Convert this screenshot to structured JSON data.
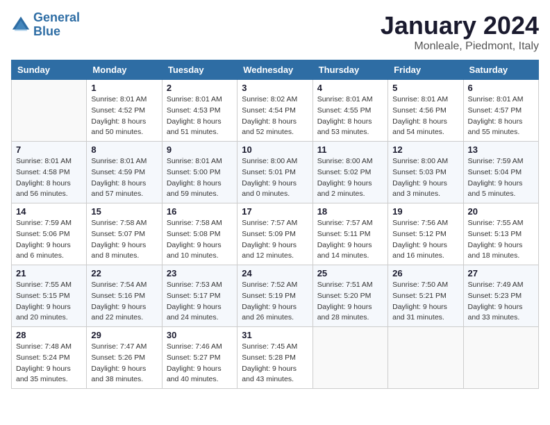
{
  "logo": {
    "line1": "General",
    "line2": "Blue"
  },
  "title": "January 2024",
  "subtitle": "Monleale, Piedmont, Italy",
  "weekdays": [
    "Sunday",
    "Monday",
    "Tuesday",
    "Wednesday",
    "Thursday",
    "Friday",
    "Saturday"
  ],
  "weeks": [
    [
      {
        "day": "",
        "info": ""
      },
      {
        "day": "1",
        "info": "Sunrise: 8:01 AM\nSunset: 4:52 PM\nDaylight: 8 hours\nand 50 minutes."
      },
      {
        "day": "2",
        "info": "Sunrise: 8:01 AM\nSunset: 4:53 PM\nDaylight: 8 hours\nand 51 minutes."
      },
      {
        "day": "3",
        "info": "Sunrise: 8:02 AM\nSunset: 4:54 PM\nDaylight: 8 hours\nand 52 minutes."
      },
      {
        "day": "4",
        "info": "Sunrise: 8:01 AM\nSunset: 4:55 PM\nDaylight: 8 hours\nand 53 minutes."
      },
      {
        "day": "5",
        "info": "Sunrise: 8:01 AM\nSunset: 4:56 PM\nDaylight: 8 hours\nand 54 minutes."
      },
      {
        "day": "6",
        "info": "Sunrise: 8:01 AM\nSunset: 4:57 PM\nDaylight: 8 hours\nand 55 minutes."
      }
    ],
    [
      {
        "day": "7",
        "info": "Sunrise: 8:01 AM\nSunset: 4:58 PM\nDaylight: 8 hours\nand 56 minutes."
      },
      {
        "day": "8",
        "info": "Sunrise: 8:01 AM\nSunset: 4:59 PM\nDaylight: 8 hours\nand 57 minutes."
      },
      {
        "day": "9",
        "info": "Sunrise: 8:01 AM\nSunset: 5:00 PM\nDaylight: 8 hours\nand 59 minutes."
      },
      {
        "day": "10",
        "info": "Sunrise: 8:00 AM\nSunset: 5:01 PM\nDaylight: 9 hours\nand 0 minutes."
      },
      {
        "day": "11",
        "info": "Sunrise: 8:00 AM\nSunset: 5:02 PM\nDaylight: 9 hours\nand 2 minutes."
      },
      {
        "day": "12",
        "info": "Sunrise: 8:00 AM\nSunset: 5:03 PM\nDaylight: 9 hours\nand 3 minutes."
      },
      {
        "day": "13",
        "info": "Sunrise: 7:59 AM\nSunset: 5:04 PM\nDaylight: 9 hours\nand 5 minutes."
      }
    ],
    [
      {
        "day": "14",
        "info": "Sunrise: 7:59 AM\nSunset: 5:06 PM\nDaylight: 9 hours\nand 6 minutes."
      },
      {
        "day": "15",
        "info": "Sunrise: 7:58 AM\nSunset: 5:07 PM\nDaylight: 9 hours\nand 8 minutes."
      },
      {
        "day": "16",
        "info": "Sunrise: 7:58 AM\nSunset: 5:08 PM\nDaylight: 9 hours\nand 10 minutes."
      },
      {
        "day": "17",
        "info": "Sunrise: 7:57 AM\nSunset: 5:09 PM\nDaylight: 9 hours\nand 12 minutes."
      },
      {
        "day": "18",
        "info": "Sunrise: 7:57 AM\nSunset: 5:11 PM\nDaylight: 9 hours\nand 14 minutes."
      },
      {
        "day": "19",
        "info": "Sunrise: 7:56 AM\nSunset: 5:12 PM\nDaylight: 9 hours\nand 16 minutes."
      },
      {
        "day": "20",
        "info": "Sunrise: 7:55 AM\nSunset: 5:13 PM\nDaylight: 9 hours\nand 18 minutes."
      }
    ],
    [
      {
        "day": "21",
        "info": "Sunrise: 7:55 AM\nSunset: 5:15 PM\nDaylight: 9 hours\nand 20 minutes."
      },
      {
        "day": "22",
        "info": "Sunrise: 7:54 AM\nSunset: 5:16 PM\nDaylight: 9 hours\nand 22 minutes."
      },
      {
        "day": "23",
        "info": "Sunrise: 7:53 AM\nSunset: 5:17 PM\nDaylight: 9 hours\nand 24 minutes."
      },
      {
        "day": "24",
        "info": "Sunrise: 7:52 AM\nSunset: 5:19 PM\nDaylight: 9 hours\nand 26 minutes."
      },
      {
        "day": "25",
        "info": "Sunrise: 7:51 AM\nSunset: 5:20 PM\nDaylight: 9 hours\nand 28 minutes."
      },
      {
        "day": "26",
        "info": "Sunrise: 7:50 AM\nSunset: 5:21 PM\nDaylight: 9 hours\nand 31 minutes."
      },
      {
        "day": "27",
        "info": "Sunrise: 7:49 AM\nSunset: 5:23 PM\nDaylight: 9 hours\nand 33 minutes."
      }
    ],
    [
      {
        "day": "28",
        "info": "Sunrise: 7:48 AM\nSunset: 5:24 PM\nDaylight: 9 hours\nand 35 minutes."
      },
      {
        "day": "29",
        "info": "Sunrise: 7:47 AM\nSunset: 5:26 PM\nDaylight: 9 hours\nand 38 minutes."
      },
      {
        "day": "30",
        "info": "Sunrise: 7:46 AM\nSunset: 5:27 PM\nDaylight: 9 hours\nand 40 minutes."
      },
      {
        "day": "31",
        "info": "Sunrise: 7:45 AM\nSunset: 5:28 PM\nDaylight: 9 hours\nand 43 minutes."
      },
      {
        "day": "",
        "info": ""
      },
      {
        "day": "",
        "info": ""
      },
      {
        "day": "",
        "info": ""
      }
    ]
  ]
}
